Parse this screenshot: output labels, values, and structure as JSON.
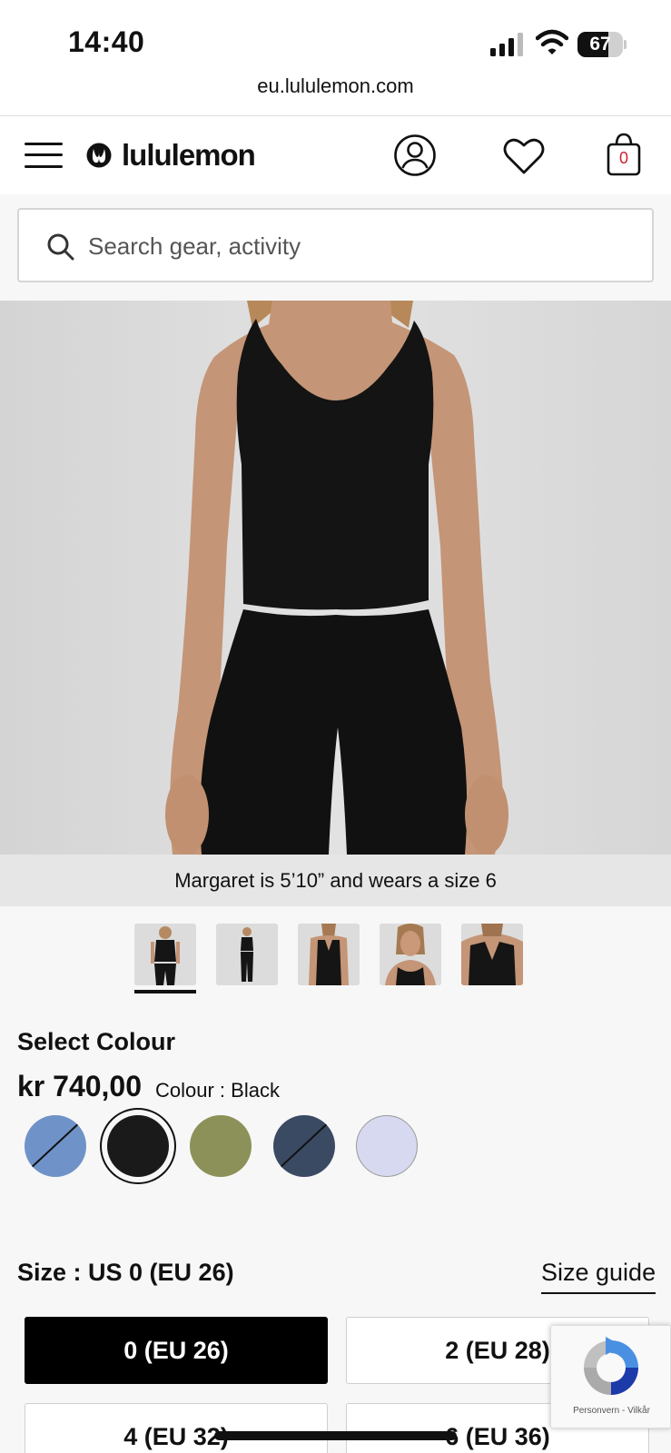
{
  "status_bar": {
    "time": "14:40",
    "battery": "67",
    "battery_level": 0.67
  },
  "browser": {
    "url": "eu.lululemon.com"
  },
  "header": {
    "brand": "lululemon",
    "bag_count": "0"
  },
  "search": {
    "placeholder": "Search gear, activity"
  },
  "product": {
    "model_caption": "Margaret is 5’10” and wears a size 6",
    "thumbnails": [
      {
        "name": "thumb-front"
      },
      {
        "name": "thumb-full"
      },
      {
        "name": "thumb-back"
      },
      {
        "name": "thumb-face"
      },
      {
        "name": "thumb-back-closeup"
      }
    ],
    "active_thumbnail": 1
  },
  "colour": {
    "section_title": "Select Colour",
    "price": "kr 740,00",
    "selected_label": "Colour : Black",
    "swatches": [
      {
        "name": "blue-denim",
        "color": "#6f93c8",
        "available": false
      },
      {
        "name": "black",
        "color": "#1a1a1a",
        "available": true,
        "selected": true
      },
      {
        "name": "olive",
        "color": "#8b9158",
        "available": true
      },
      {
        "name": "navy",
        "color": "#3b4a63",
        "available": false
      },
      {
        "name": "lavender",
        "color": "#d6d9ef",
        "available": true
      }
    ]
  },
  "size": {
    "label": "Size : US 0 (EU 26)",
    "guide_link": "Size guide",
    "options": [
      "0 (EU 26)",
      "2 (EU 28)",
      "4 (EU 32)",
      "6 (EU 36)"
    ],
    "selected": "0 (EU 26)"
  },
  "recaptcha": {
    "text": "Personvern - Vilkår"
  }
}
